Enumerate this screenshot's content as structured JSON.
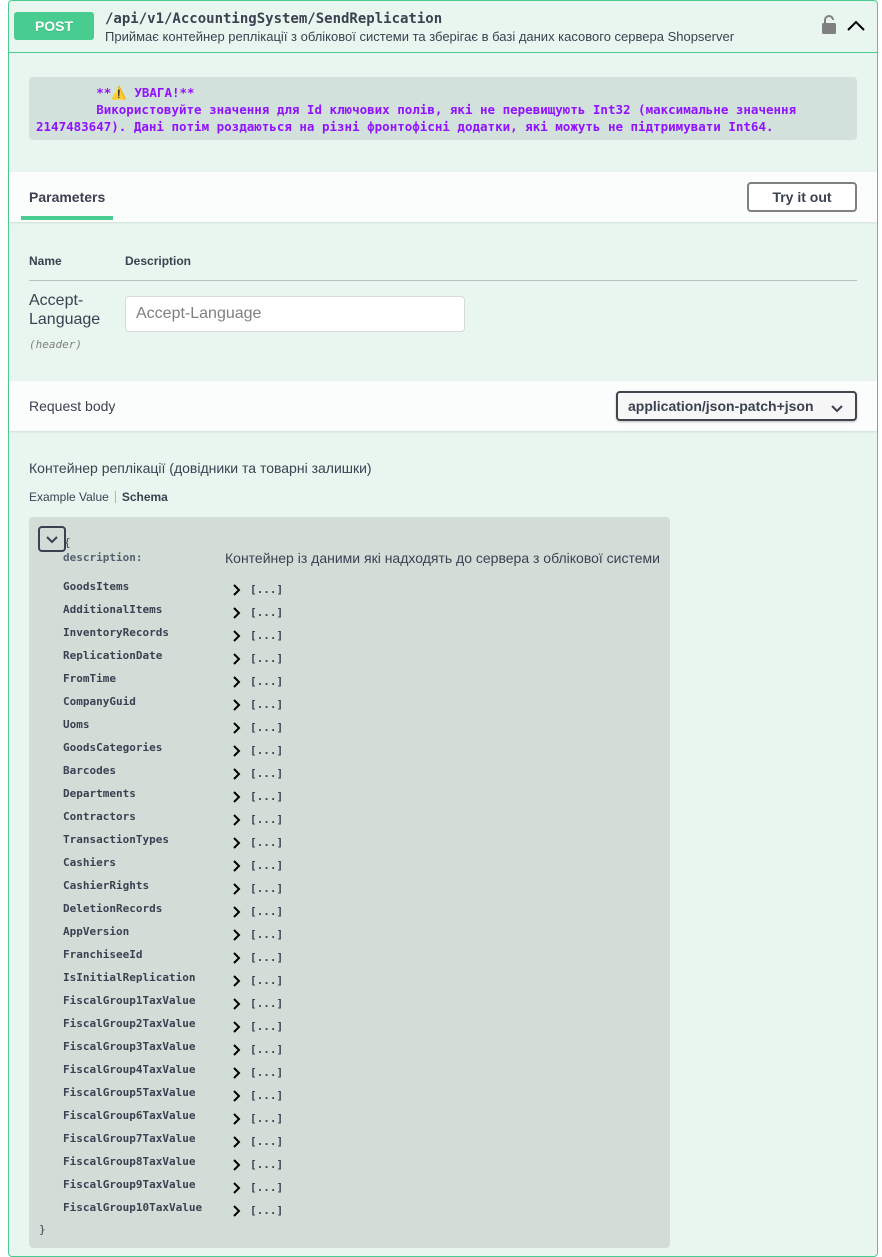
{
  "operation": {
    "method": "POST",
    "path": "/api/v1/AccountingSystem/SendReplication",
    "summary": "Приймає контейнер реплікації з облікової системи та зберігає в базі даних касового сервера Shopserver",
    "lock_icon": "lock-icon",
    "collapse_icon": "chevron-up-icon"
  },
  "warning": {
    "line1": "        **⚠️ УВАГА!**",
    "line2": "        Використовуйте значення для Id ключових полів, які не перевищують Int32 (максимальне значення",
    "line3": "2147483647). Дані потім роздаються на різні фронтофісні додатки, які можуть не підтримувати Int64."
  },
  "parameters": {
    "tab_label": "Parameters",
    "try_button": "Try it out",
    "col_name": "Name",
    "col_description": "Description",
    "items": [
      {
        "name_line1": "Accept-",
        "name_line2": "Language",
        "in": "(header)",
        "placeholder": "Accept-Language"
      }
    ]
  },
  "request_body": {
    "label": "Request body",
    "content_type": "application/json-patch+json",
    "description": "Контейнер реплікації (довідники та товарні залишки)",
    "tabs": [
      "Example Value",
      "Schema"
    ],
    "active_tab": "Schema"
  },
  "schema": {
    "open_brace": "{",
    "close_brace": "}",
    "description_key": "description:",
    "description_value": "Контейнер із даними які надходять до сервера з облікової системи",
    "collapsed_value": "[...]",
    "properties": [
      "GoodsItems",
      "AdditionalItems",
      "InventoryRecords",
      "ReplicationDate",
      "FromTime",
      "CompanyGuid",
      "Uoms",
      "GoodsCategories",
      "Barcodes",
      "Departments",
      "Contractors",
      "TransactionTypes",
      "Cashiers",
      "CashierRights",
      "DeletionRecords",
      "AppVersion",
      "FranchiseeId",
      "IsInitialReplication",
      "FiscalGroup1TaxValue",
      "FiscalGroup2TaxValue",
      "FiscalGroup3TaxValue",
      "FiscalGroup4TaxValue",
      "FiscalGroup5TaxValue",
      "FiscalGroup6TaxValue",
      "FiscalGroup7TaxValue",
      "FiscalGroup8TaxValue",
      "FiscalGroup9TaxValue",
      "FiscalGroup10TaxValue"
    ]
  },
  "colors": {
    "post_green": "#49cc90",
    "block_bg": "#e8f6ef",
    "warning_text": "#9012fe",
    "model_bg": "#d3ddd8"
  }
}
